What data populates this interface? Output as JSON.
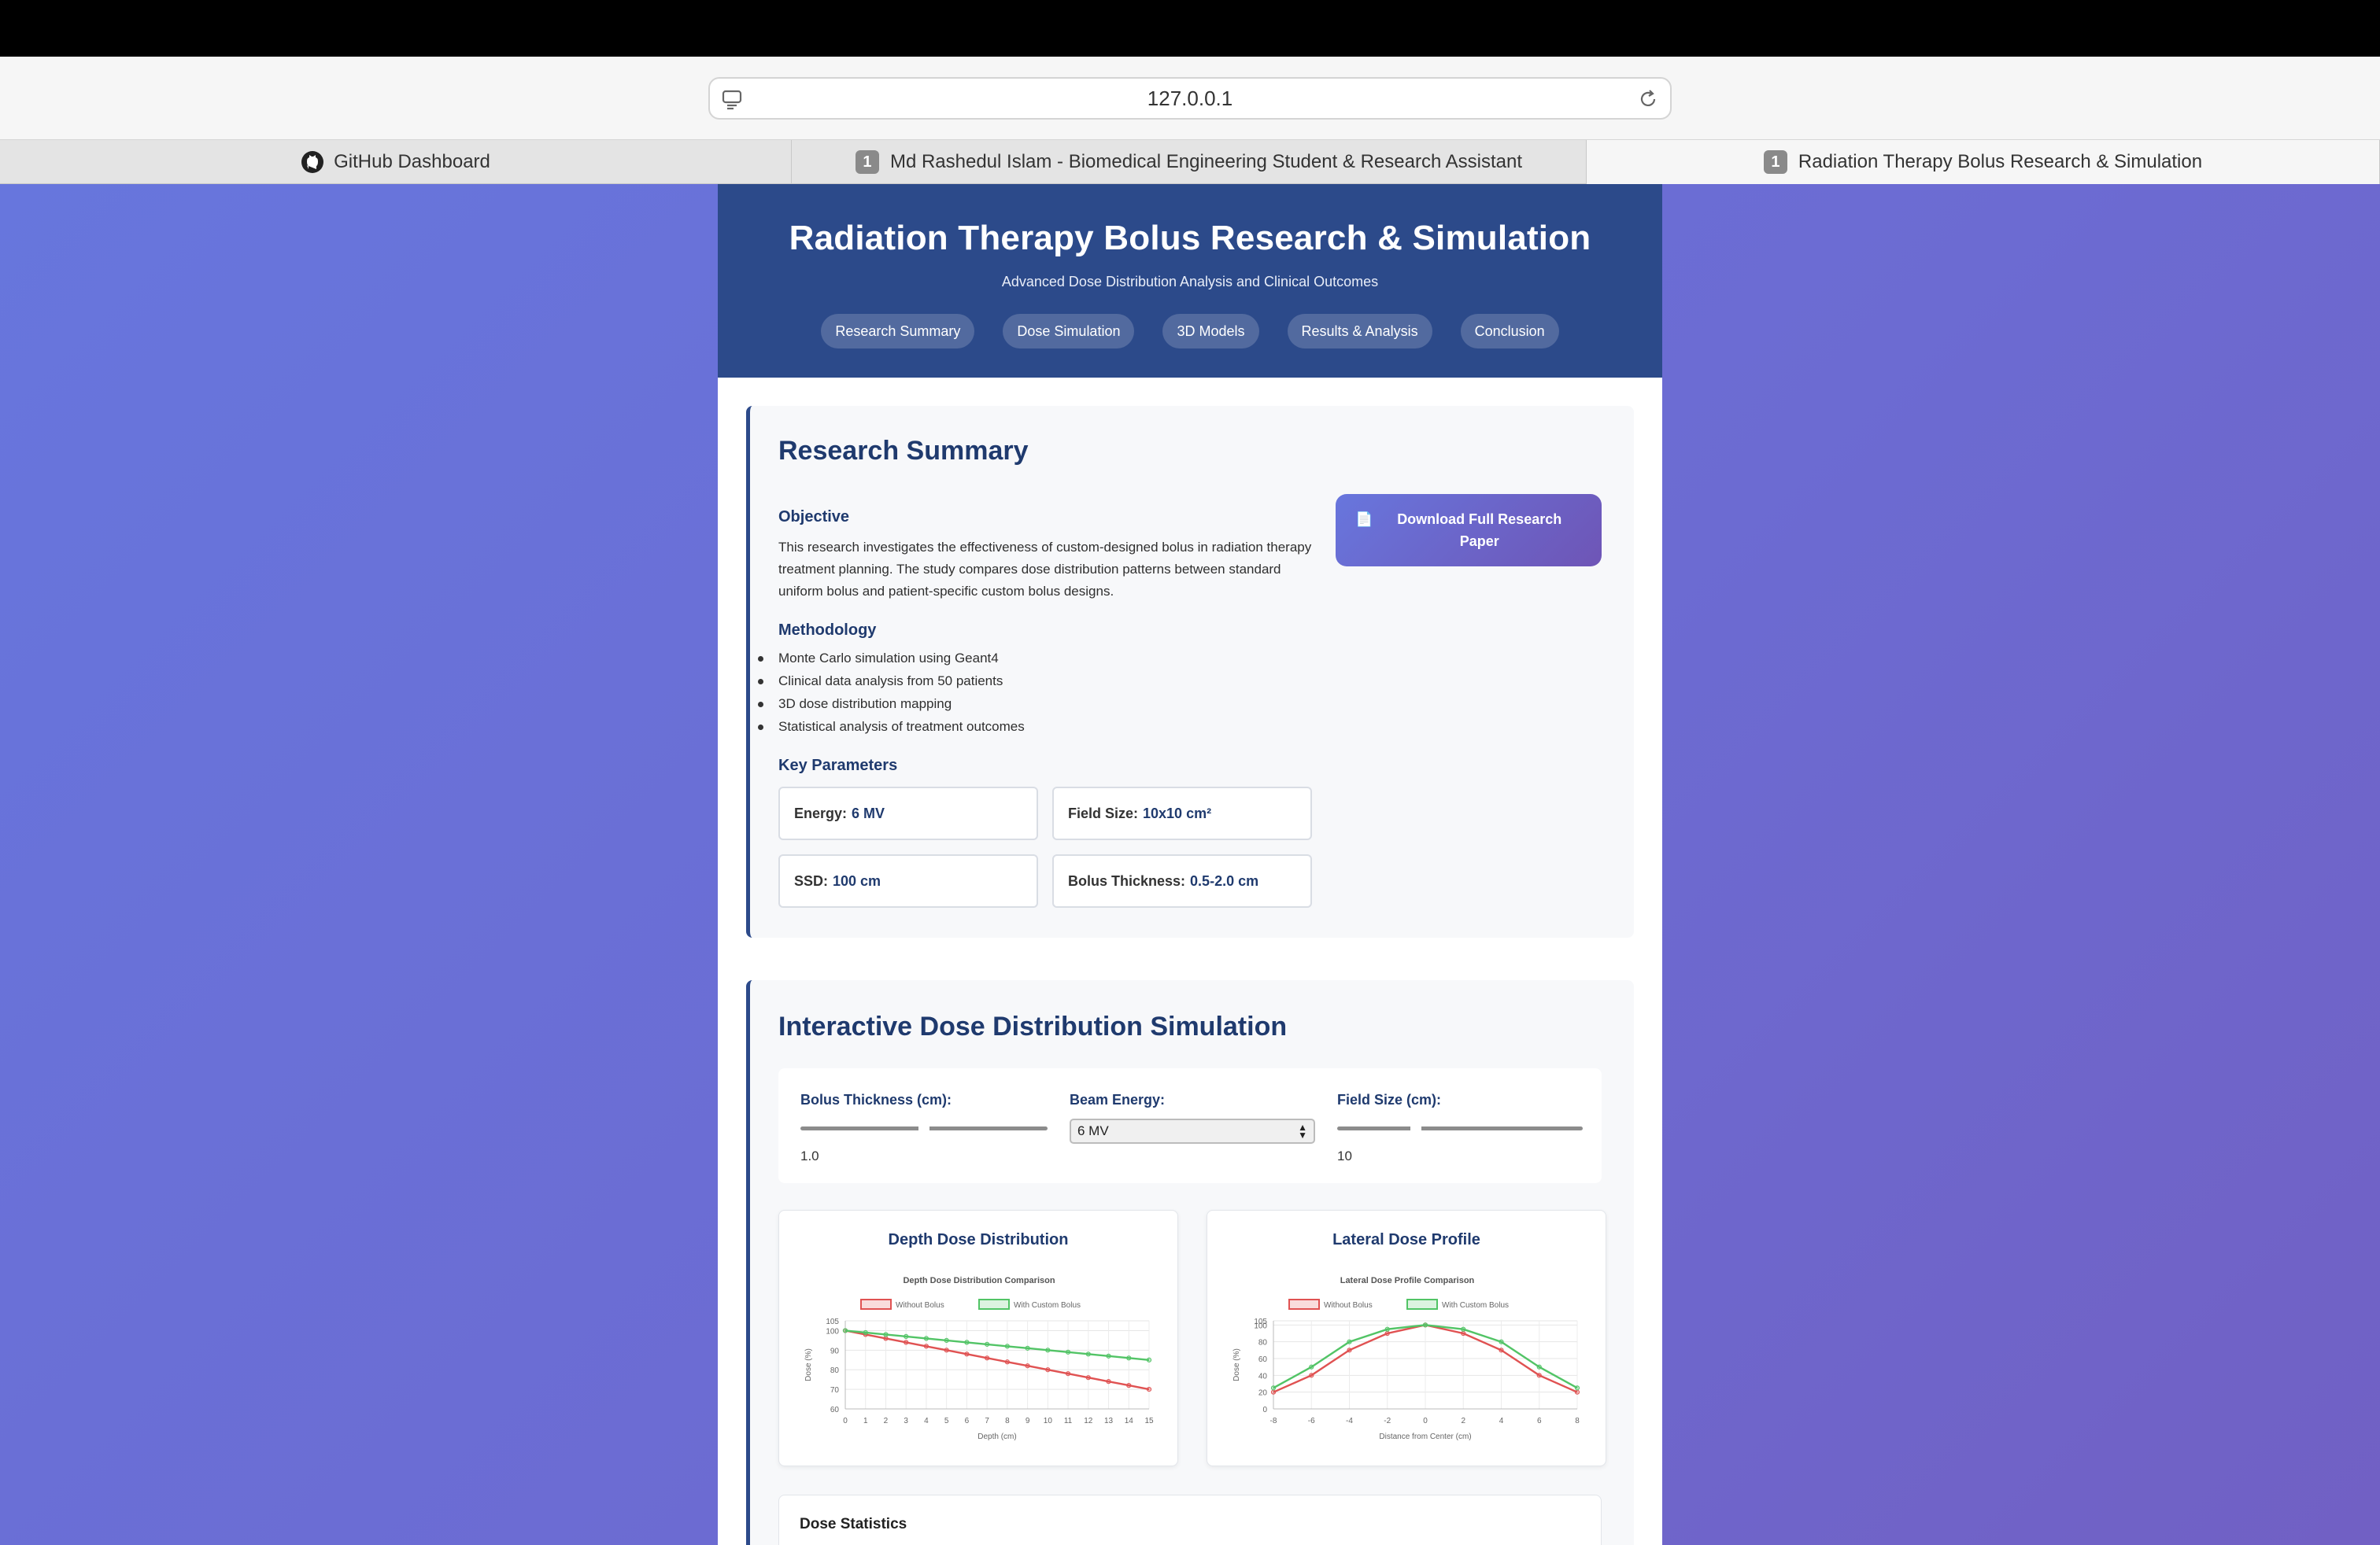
{
  "browser": {
    "url": "127.0.0.1",
    "tabs": [
      {
        "label": "GitHub Dashboard",
        "badge": ""
      },
      {
        "label": "Md Rashedul Islam - Biomedical Engineering Student & Research Assistant",
        "badge": "1"
      },
      {
        "label": "Radiation Therapy Bolus Research & Simulation",
        "badge": "1"
      }
    ]
  },
  "header": {
    "title": "Radiation Therapy Bolus Research & Simulation",
    "subtitle": "Advanced Dose Distribution Analysis and Clinical Outcomes",
    "nav": [
      "Research Summary",
      "Dose Simulation",
      "3D Models",
      "Results & Analysis",
      "Conclusion"
    ]
  },
  "summary": {
    "title": "Research Summary",
    "objective_heading": "Objective",
    "objective_text": "This research investigates the effectiveness of custom-designed bolus in radiation therapy treatment planning. The study compares dose distribution patterns between standard uniform bolus and patient-specific custom bolus designs.",
    "methodology_heading": "Methodology",
    "methodology": [
      "Monte Carlo simulation using Geant4",
      "Clinical data analysis from 50 patients",
      "3D dose distribution mapping",
      "Statistical analysis of treatment outcomes"
    ],
    "params_heading": "Key Parameters",
    "params": [
      {
        "label": "Energy:",
        "value": "6 MV"
      },
      {
        "label": "Field Size:",
        "value": "10x10 cm²"
      },
      {
        "label": "SSD:",
        "value": "100 cm"
      },
      {
        "label": "Bolus Thickness:",
        "value": "0.5-2.0 cm"
      }
    ],
    "download_icon": "📄",
    "download_label": "Download Full Research Paper"
  },
  "simulation": {
    "title": "Interactive Dose Distribution Simulation",
    "controls": {
      "bolus_label": "Bolus Thickness (cm):",
      "bolus_value": "1.0",
      "bolus_fraction": 0.5,
      "energy_label": "Beam Energy:",
      "energy_selected": "6 MV",
      "field_label": "Field Size (cm):",
      "field_value": "10",
      "field_fraction": 0.32
    },
    "stats_title": "Dose Statistics"
  },
  "chart_data": [
    {
      "type": "line",
      "card_title": "Depth Dose Distribution",
      "title": "Depth Dose Distribution Comparison",
      "xlabel": "Depth (cm)",
      "ylabel": "Dose (%)",
      "x": [
        0,
        1,
        2,
        3,
        4,
        5,
        6,
        7,
        8,
        9,
        10,
        11,
        12,
        13,
        14,
        15
      ],
      "ylim": [
        60,
        105
      ],
      "yticks": [
        60,
        70,
        80,
        90,
        100,
        105
      ],
      "series": [
        {
          "name": "Without Bolus",
          "color": "#e05252",
          "values": [
            100,
            98,
            96,
            94,
            92,
            90,
            88,
            86,
            84,
            82,
            80,
            78,
            76,
            74,
            72,
            70
          ]
        },
        {
          "name": "With Custom Bolus",
          "color": "#52c466",
          "values": [
            100,
            99,
            98,
            97,
            96,
            95,
            94,
            93,
            92,
            91,
            90,
            89,
            88,
            87,
            86,
            85
          ]
        }
      ],
      "legend": "top",
      "grid": true
    },
    {
      "type": "line",
      "card_title": "Lateral Dose Profile",
      "title": "Lateral Dose Profile Comparison",
      "xlabel": "Distance from Center (cm)",
      "ylabel": "Dose (%)",
      "x": [
        -8,
        -6,
        -4,
        -2,
        0,
        2,
        4,
        6,
        8
      ],
      "xticks": [
        -8,
        -6,
        -4,
        -2,
        0,
        2,
        4,
        6,
        8
      ],
      "ylim": [
        0,
        105
      ],
      "yticks": [
        0,
        20,
        40,
        60,
        80,
        100,
        105
      ],
      "series": [
        {
          "name": "Without Bolus",
          "color": "#e05252",
          "values": [
            20,
            40,
            70,
            90,
            100,
            90,
            70,
            40,
            20
          ]
        },
        {
          "name": "With Custom Bolus",
          "color": "#52c466",
          "values": [
            25,
            50,
            80,
            95,
            100,
            95,
            80,
            50,
            25
          ]
        }
      ],
      "legend": "top",
      "grid": true
    }
  ]
}
